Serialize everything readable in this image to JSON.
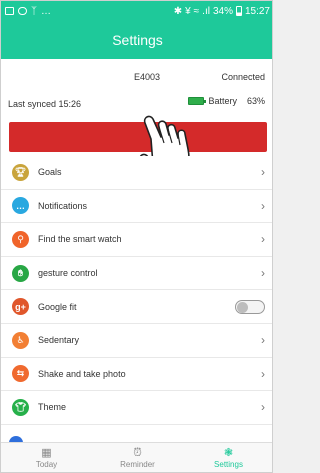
{
  "status_bar": {
    "icons_left": [
      "image-icon",
      "app-icon",
      "usb-icon"
    ],
    "icons_right": [
      "bluetooth-icon",
      "mute-icon",
      "wifi-icon",
      "signal-icon",
      "battery-icon"
    ],
    "battery": "34%",
    "time": "15:27"
  },
  "header": {
    "title": "Settings"
  },
  "device": {
    "name": "E4003",
    "connection": "Connected",
    "last_synced": "Last synced  15:26",
    "battery_label": "Battery",
    "battery_value": "63%"
  },
  "menu": {
    "items": [
      {
        "label": "Goals",
        "icon": "trophy-icon",
        "color": "#c9a43c",
        "control": "chevron"
      },
      {
        "label": "Notifications",
        "icon": "chat-icon",
        "color": "#29a8e0",
        "control": "chevron"
      },
      {
        "label": "Find the smart watch",
        "icon": "search-icon",
        "color": "#f0642a",
        "control": "chevron"
      },
      {
        "label": "gesture control",
        "icon": "hand-icon",
        "color": "#28a745",
        "control": "chevron"
      },
      {
        "label": "Google fit",
        "icon": "google-plus-icon",
        "color": "#e0572c",
        "control": "toggle",
        "enabled": false
      },
      {
        "label": "Sedentary",
        "icon": "sitting-icon",
        "color": "#f27f34",
        "control": "chevron"
      },
      {
        "label": "Shake and take photo",
        "icon": "shake-icon",
        "color": "#f06a2f",
        "control": "chevron"
      },
      {
        "label": "Theme",
        "icon": "shirt-icon",
        "color": "#26b04a",
        "control": "chevron"
      }
    ]
  },
  "tabs": [
    {
      "label": "Today",
      "icon": "calendar-icon",
      "active": false
    },
    {
      "label": "Reminder",
      "icon": "alarm-clock-icon",
      "active": false
    },
    {
      "label": "Settings",
      "icon": "settings-icon",
      "active": true
    }
  ],
  "colors": {
    "accent": "#1ec99a",
    "banner": "#d42a2a"
  }
}
